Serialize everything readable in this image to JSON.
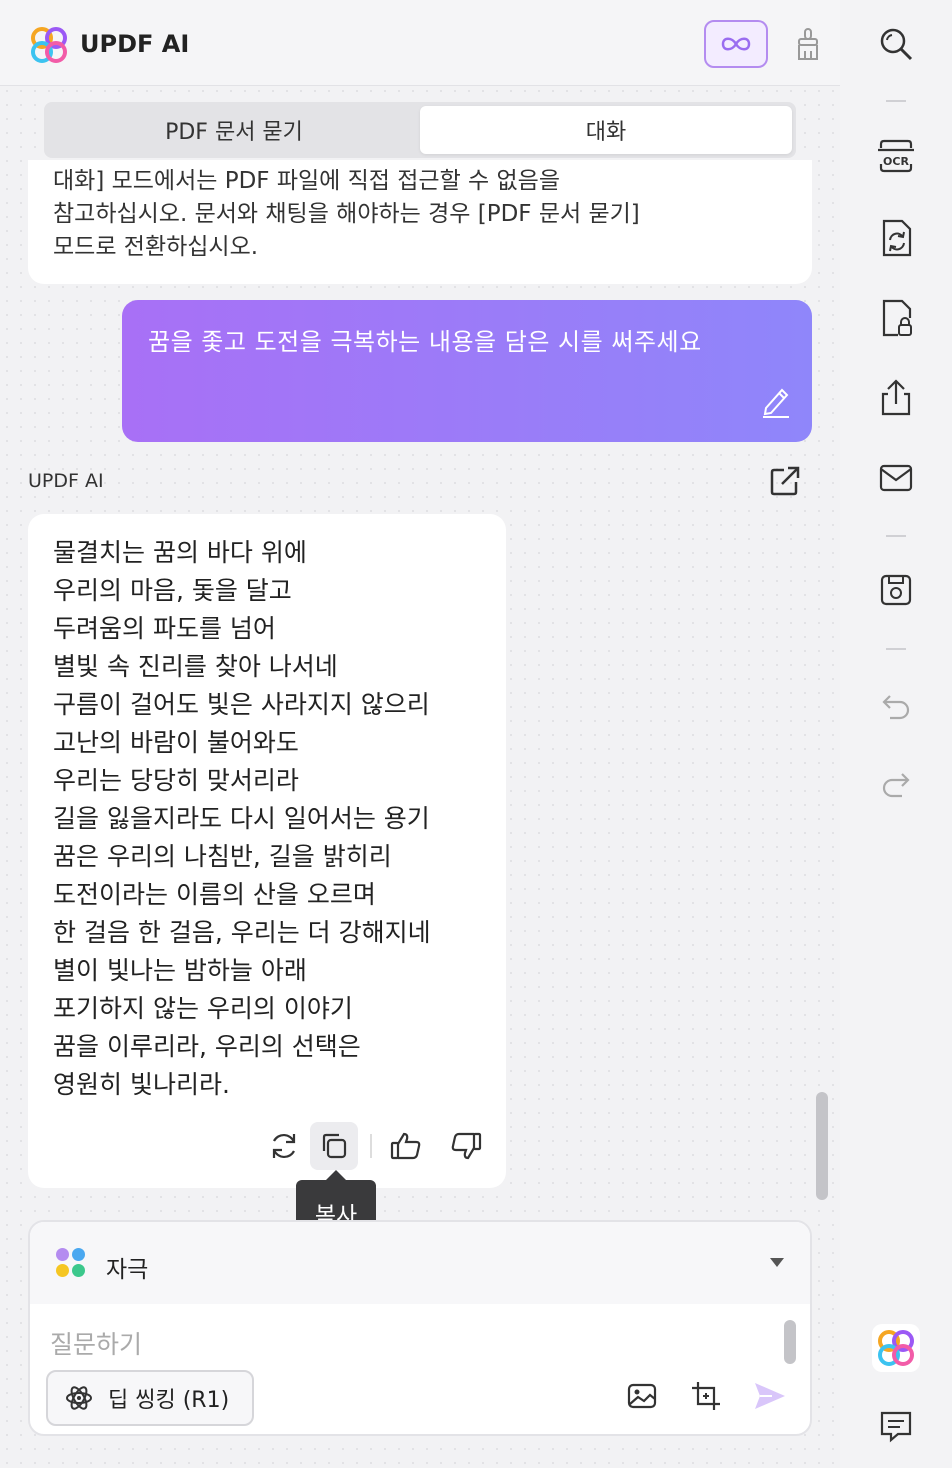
{
  "header": {
    "app_title": "UPDF AI",
    "logo_icon": "updf-logo-icon",
    "infinity_icon": "infinity-icon",
    "brush_icon": "brush-icon"
  },
  "mode_tabs": [
    {
      "label": "PDF 문서 묻기",
      "active": false
    },
    {
      "label": "대화",
      "active": true
    }
  ],
  "messages": {
    "previous_ai": {
      "lines": [
        "대화] 모드에서는 PDF 파일에 직접 접근할 수 없음을",
        "참고하십시오. 문서와 채팅을 해야하는 경우 [PDF 문서 묻기]",
        "모드로 전환하십시오."
      ]
    },
    "user": {
      "text": "꿈을 좇고 도전을 극복하는 내용을 담은 시를 써주세요",
      "gradient_start": "#a870f6",
      "gradient_end": "#8f86fa"
    },
    "ai": {
      "sender": "UPDF AI",
      "poem_lines": [
        "물결치는 꿈의 바다 위에",
        "우리의 마음, 돛을 달고",
        "두려움의 파도를 넘어",
        "별빛 속 진리를 찾아 나서네",
        "구름이 걸어도 빛은 사라지지 않으리",
        "고난의 바람이 불어와도",
        "우리는 당당히 맞서리라",
        "길을 잃을지라도 다시 일어서는 용기",
        "꿈은 우리의 나침반, 길을 밝히리",
        "도전이라는 이름의 산을 오르며",
        "한 걸음 한 걸음, 우리는 더 강해지네",
        "별이 빛나는 밤하늘 아래",
        "포기하지 않는 우리의 이야기",
        "꿈을 이루리라, 우리의 선택은",
        "영원히 빛나리라."
      ],
      "tooltip": "복사"
    }
  },
  "composer": {
    "prompt_label": "자극",
    "placeholder": "질문하기",
    "deep_thinking_label": "딥 씽킹 (R1)"
  },
  "sidebar": {
    "icons": [
      "search-icon",
      "ocr-icon",
      "convert-icon",
      "protect-icon",
      "share-icon",
      "mail-icon",
      "save-icon",
      "undo-icon",
      "redo-icon",
      "updf-ai-icon",
      "comment-icon"
    ]
  },
  "colors": {
    "accent": "#a870f6",
    "tooltip_bg": "#3a3a3c"
  }
}
